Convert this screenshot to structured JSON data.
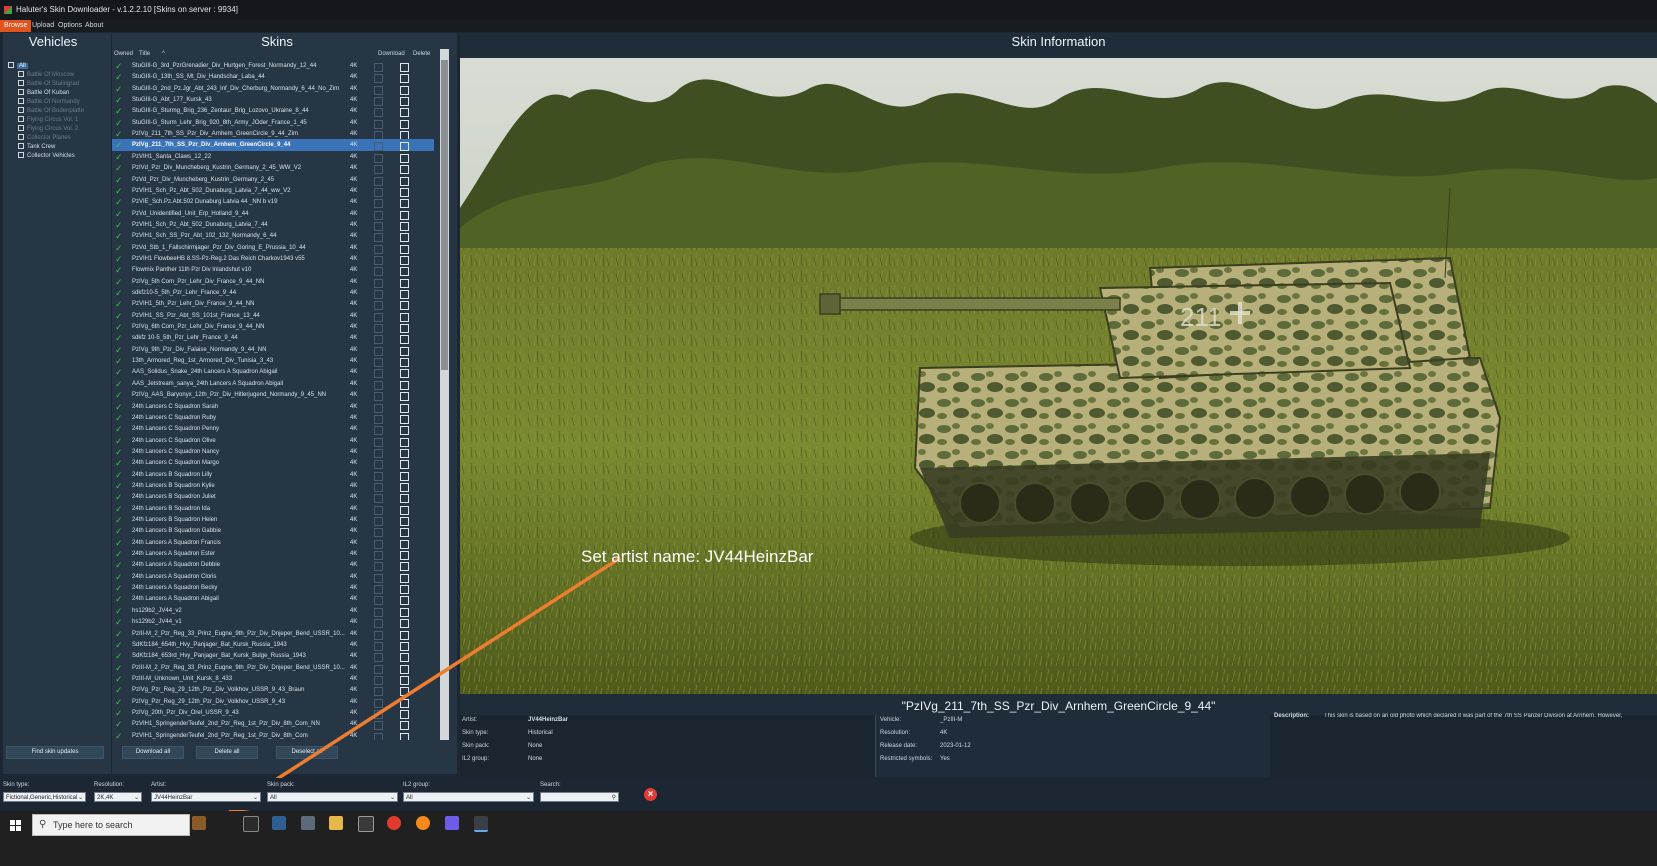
{
  "titlebar": {
    "title": "Haluter's Skin Downloader - v.1.2.2.10 [Skins on server : 9934]"
  },
  "menu": [
    "Browse",
    "Upload",
    "Options",
    "About"
  ],
  "panels": {
    "vehicles": "Vehicles",
    "skins": "Skins",
    "skin_information": "Skin Information"
  },
  "vehicle_tree": [
    {
      "label": "All",
      "dim": false,
      "selected": true
    },
    {
      "label": "Battle Of Moscow",
      "dim": true
    },
    {
      "label": "Battle Of Stalingrad",
      "dim": true
    },
    {
      "label": "Battle Of Kuban",
      "dim": false
    },
    {
      "label": "Battle Of Normandy",
      "dim": true
    },
    {
      "label": "Battle Of Bodenplatte",
      "dim": true
    },
    {
      "label": "Flying Circus Vol. 1",
      "dim": true
    },
    {
      "label": "Flying Circus Vol. 2",
      "dim": true
    },
    {
      "label": "Collector Planes",
      "dim": true
    },
    {
      "label": "Tank Crew",
      "dim": false
    },
    {
      "label": "Collector Vehicles",
      "dim": false
    }
  ],
  "skin_columns": {
    "owned": "Owned",
    "title": "Title",
    "download": "Download",
    "delete": "Delete"
  },
  "skins": [
    {
      "name": "StuGIII-G_3rd_PzrGrenadier_Div_Hurtgen_Forest_Normandy_12_44",
      "res": "4K"
    },
    {
      "name": "StuGIII-G_13th_SS_Mt_Div_Handschar_Laba_44",
      "res": "4K"
    },
    {
      "name": "StuGIII-G_2nd_Pz.Jgr_Abt_243_Inf_Div_Cherburg_Normandy_6_44_No_Zim",
      "res": "4K"
    },
    {
      "name": "StuGIII-G_Abt_177_Kursk_43",
      "res": "4K"
    },
    {
      "name": "StuGIII-G_Sturmg_Brig_236_Zentaur_Brig_Lozovo_Ukraine_8_44",
      "res": "4K"
    },
    {
      "name": "StuGIII-G_Sturm_Lehr_Brig_920_8th_Army_JOder_France_1_45",
      "res": "4K"
    },
    {
      "name": "PzIVg_211_7th_SS_Pzr_Div_Arnhem_GreenCircle_9_44_Zim",
      "res": "4K"
    },
    {
      "name": "PzIVg_211_7th_SS_Pzr_Div_Arnhem_GreenCircle_9_44",
      "res": "4K",
      "selected": true
    },
    {
      "name": "PzVIH1_Santa_Claws_12_22",
      "res": "4K"
    },
    {
      "name": "PzIVd_Pzr_Div_Muncheberg_Kustrin_Germany_2_45_WW_V2",
      "res": "4K"
    },
    {
      "name": "PzVd_Pzr_Div_Muncheberg_Kustrin_Germany_2_45",
      "res": "4K"
    },
    {
      "name": "PzVIH1_Sch_Pz_Abt_502_Dunaburg_Latvia_7_44_ww_V2",
      "res": "4K"
    },
    {
      "name": "PzVIE_Sch.Pz.Abt.502 Dunaburg Latvia 44 _NN b v19",
      "res": "4K"
    },
    {
      "name": "PzVd_Unidentified_Unit_Erp_Holland_9_44",
      "res": "4K"
    },
    {
      "name": "PzVIH1_Sch_Pz_Abt_502_Dunaburg_Latvia_7_44",
      "res": "4K"
    },
    {
      "name": "PzVIH1_Sch_SS_Pzr_Abt_102_132_Normandy_6_44",
      "res": "4K"
    },
    {
      "name": "PzVd_Stb_1_Fallschirmjager_Pzr_Div_Goring_E_Prussia_10_44",
      "res": "4K"
    },
    {
      "name": "PzVIH1 FlowbeeHB 8.SS-Pz-Reg.2 Das Reich Charkov1943 v55",
      "res": "4K"
    },
    {
      "name": "Flowmix Panther 11th Pzr Div Inlandshut v10",
      "res": "4K"
    },
    {
      "name": "PzIVg_5th Com_Pzr_Lehr_Div_France_9_44_NN",
      "res": "4K"
    },
    {
      "name": "sdkfz10-5_5th_Pzr_Lehr_France_9_44",
      "res": "4K"
    },
    {
      "name": "PzVIH1_5th_Pzr_Lehr_Div_France_9_44_NN",
      "res": "4K"
    },
    {
      "name": "PzVIH1_SS_Pzr_Abt_SS_101st_France_13_44",
      "res": "4K"
    },
    {
      "name": "PzIVg_6th Com_Pzr_Lehr_Div_France_9_44_NN",
      "res": "4K"
    },
    {
      "name": "sdkfz 10-5_5th_Pzr_Lehr_France_9_44",
      "res": "4K"
    },
    {
      "name": "PzIVg_9th_Pzr_Div_Falaise_Normandy_9_44_NN",
      "res": "4K"
    },
    {
      "name": "13th_Armored_Reg_1st_Armored_Div_Tunisia_3_43",
      "res": "4K"
    },
    {
      "name": "AAS_Solidus_Snake_24th Lancers A Squadron Abigail",
      "res": "4K"
    },
    {
      "name": "AAS_Jetstream_sanya_24th Lancers A Squadron Abigail",
      "res": "4K"
    },
    {
      "name": "PzIVg_AAS_Baryonyx_12th_Pzr_Div_Hitlerjugend_Normandy_9_45_NN",
      "res": "4K"
    },
    {
      "name": "24th Lancers C Squadron Sarah",
      "res": "4K"
    },
    {
      "name": "24th Lancers C Squadron Ruby",
      "res": "4K"
    },
    {
      "name": "24th Lancers C Squadron Penny",
      "res": "4K"
    },
    {
      "name": "24th Lancers C Squadron Olive",
      "res": "4K"
    },
    {
      "name": "24th Lancers C Squadron Nancy",
      "res": "4K"
    },
    {
      "name": "24th Lancers C Squadron Margo",
      "res": "4K"
    },
    {
      "name": "24th Lancers B Squadron Lilly",
      "res": "4K"
    },
    {
      "name": "24th Lancers B Squadron Kylie",
      "res": "4K"
    },
    {
      "name": "24th Lancers B Squadron Juliet",
      "res": "4K"
    },
    {
      "name": "24th Lancers B Squadron Ida",
      "res": "4K"
    },
    {
      "name": "24th Lancers B Squadron Helen",
      "res": "4K"
    },
    {
      "name": "24th Lancers B Squadron Gabbie",
      "res": "4K"
    },
    {
      "name": "24th Lancers A Squadron Francis",
      "res": "4K"
    },
    {
      "name": "24th Lancers A Squadron Ester",
      "res": "4K"
    },
    {
      "name": "24th Lancers A Squadron Debbie",
      "res": "4K"
    },
    {
      "name": "24th Lancers A Squadron Cloris",
      "res": "4K"
    },
    {
      "name": "24th Lancers A Squadron Becky",
      "res": "4K"
    },
    {
      "name": "24th Lancers A Squadron Abigail",
      "res": "4K"
    },
    {
      "name": "hs129b2_JV44_v2",
      "res": "4K"
    },
    {
      "name": "hs129b2_JV44_v1",
      "res": "4K"
    },
    {
      "name": "PzIII-M_2_Pzr_Reg_33_Prinz_Eugne_9th_Pzr_Div_Dnjeper_Bend_USSR_10...",
      "res": "4K"
    },
    {
      "name": "SdKfz184_654th_Hvy_Panjager_Bat_Kursk_Russia_1943",
      "res": "4K"
    },
    {
      "name": "SdKfz184_653rd_Hvy_Panjager_Bat_Kursk_Bulge_Russia_1943",
      "res": "4K"
    },
    {
      "name": "PzIII-M_2_Pzr_Reg_33_Prinz_Eugne_9th_Pzr_Div_Dnjeper_Bend_USSR_10...",
      "res": "4K"
    },
    {
      "name": "PzIII-M_Unknown_Unit_Kursk_8_433",
      "res": "4K"
    },
    {
      "name": "PzIVg_Pzr_Reg_29_12th_Pzr_Div_Volkhov_USSR_9_43_Braun",
      "res": "4K"
    },
    {
      "name": "PzIVg_Pzr_Reg_29_12th_Pzr_Div_Volkhov_USSR_9_43",
      "res": "4K"
    },
    {
      "name": "PzIVg_20th_Pzr_Div_Orel_USSR_9_43",
      "res": "4K"
    },
    {
      "name": "PzVIH1_SpringenderTeufel_2nd_Pzr_Reg_1st_Pzr_Div_8th_Com_NN",
      "res": "4K"
    },
    {
      "name": "PzVIH1_SpringenderTeufel_2nd_Pzr_Reg_1st_Pzr_Div_8th_Com",
      "res": "4K"
    }
  ],
  "buttons": {
    "find_updates": "Find skin updates",
    "download_all": "Download all",
    "delete_all": "Delete all",
    "deselect_all": "Deselect all"
  },
  "skin_info": {
    "title": "\"PzIVg_211_7th_SS_Pzr_Div_Arnhem_GreenCircle_9_44\"",
    "left": [
      {
        "k": "Artist:",
        "v": "JV44HeinzBar"
      },
      {
        "k": "Skin type:",
        "v": "Historical"
      },
      {
        "k": "Skin pack:",
        "v": "None"
      },
      {
        "k": "IL2 group:",
        "v": "None"
      }
    ],
    "middle": [
      {
        "k": "Vehicle:",
        "v": "_PzIII-M"
      },
      {
        "k": "Resolution:",
        "v": "4K"
      },
      {
        "k": "Release date:",
        "v": "2023-01-12"
      },
      {
        "k": "Restricted symbols:",
        "v": "Yes"
      }
    ],
    "description_label": "Description:",
    "description": "This skin is based on an old photo which declared it was part of the 7th SS Panzer Division at Arnhem. However,",
    "tank_marking": "211"
  },
  "annotation": {
    "text": "Set artist name: JV44HeinzBar",
    "color": "#ed7d31"
  },
  "filters": {
    "skin_type": {
      "label": "Skin type:",
      "value": "Fictional,Generic,Historical"
    },
    "resolution": {
      "label": "Resolution:",
      "value": "2K,4K"
    },
    "artist": {
      "label": "Artist:",
      "value": "JV44HeinzBar"
    },
    "skin_pack": {
      "label": "Skin pack:",
      "value": "All"
    },
    "il2_group": {
      "label": "IL2 group:",
      "value": "All"
    },
    "search": {
      "label": "Search:",
      "value": ""
    }
  },
  "taskbar": {
    "search_placeholder": "Type here to search"
  },
  "colors": {
    "accent": "#e2541e",
    "selection": "#3b73b8",
    "owned_check": "#3fbf4d",
    "close": "#e53935"
  }
}
